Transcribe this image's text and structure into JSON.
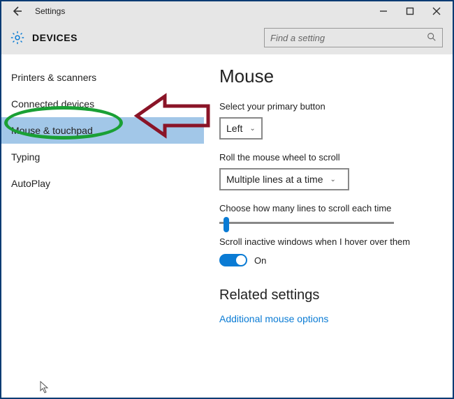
{
  "titlebar": {
    "title": "Settings"
  },
  "header": {
    "section": "DEVICES",
    "search_placeholder": "Find a setting"
  },
  "sidebar": {
    "items": [
      {
        "label": "Printers & scanners",
        "selected": false
      },
      {
        "label": "Connected devices",
        "selected": false
      },
      {
        "label": "Mouse & touchpad",
        "selected": true
      },
      {
        "label": "Typing",
        "selected": false
      },
      {
        "label": "AutoPlay",
        "selected": false
      }
    ]
  },
  "content": {
    "heading": "Mouse",
    "primary_button_label": "Select your primary button",
    "primary_button_value": "Left",
    "wheel_label": "Roll the mouse wheel to scroll",
    "wheel_value": "Multiple lines at a time",
    "lines_label": "Choose how many lines to scroll each time",
    "inactive_label": "Scroll inactive windows when I hover over them",
    "inactive_toggle_state": "On",
    "related_heading": "Related settings",
    "related_link": "Additional mouse options"
  },
  "annotations": {
    "circle_target": "Mouse & touchpad",
    "arrow_points_to": "Mouse & touchpad"
  }
}
